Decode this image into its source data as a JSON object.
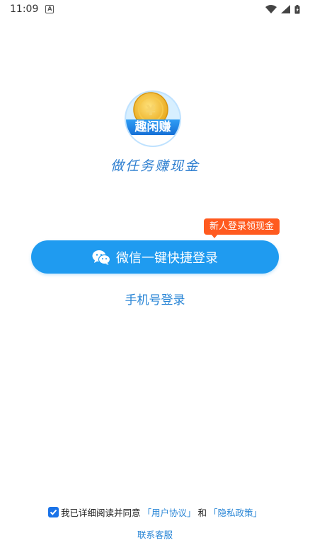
{
  "status_bar": {
    "time": "11:09",
    "notification_letter": "A"
  },
  "app": {
    "logo_text": "趣闲赚",
    "slogan": "做任务赚现金"
  },
  "promo_badge": {
    "text": "新人登录领现金"
  },
  "wechat_login": {
    "label": "微信一键快捷登录",
    "icon": "wechat-icon"
  },
  "phone_login": {
    "label": "手机号登录"
  },
  "agreement": {
    "checked": true,
    "prefix": "我已详细阅读并同意",
    "user_agreement": "「用户协议」",
    "and": "和",
    "privacy_policy": "「隐私政策」"
  },
  "support": {
    "label": "联系客服"
  },
  "colors": {
    "primary": "#1f9bf0",
    "badge": "#ff5a1f",
    "link": "#2a86d6"
  }
}
